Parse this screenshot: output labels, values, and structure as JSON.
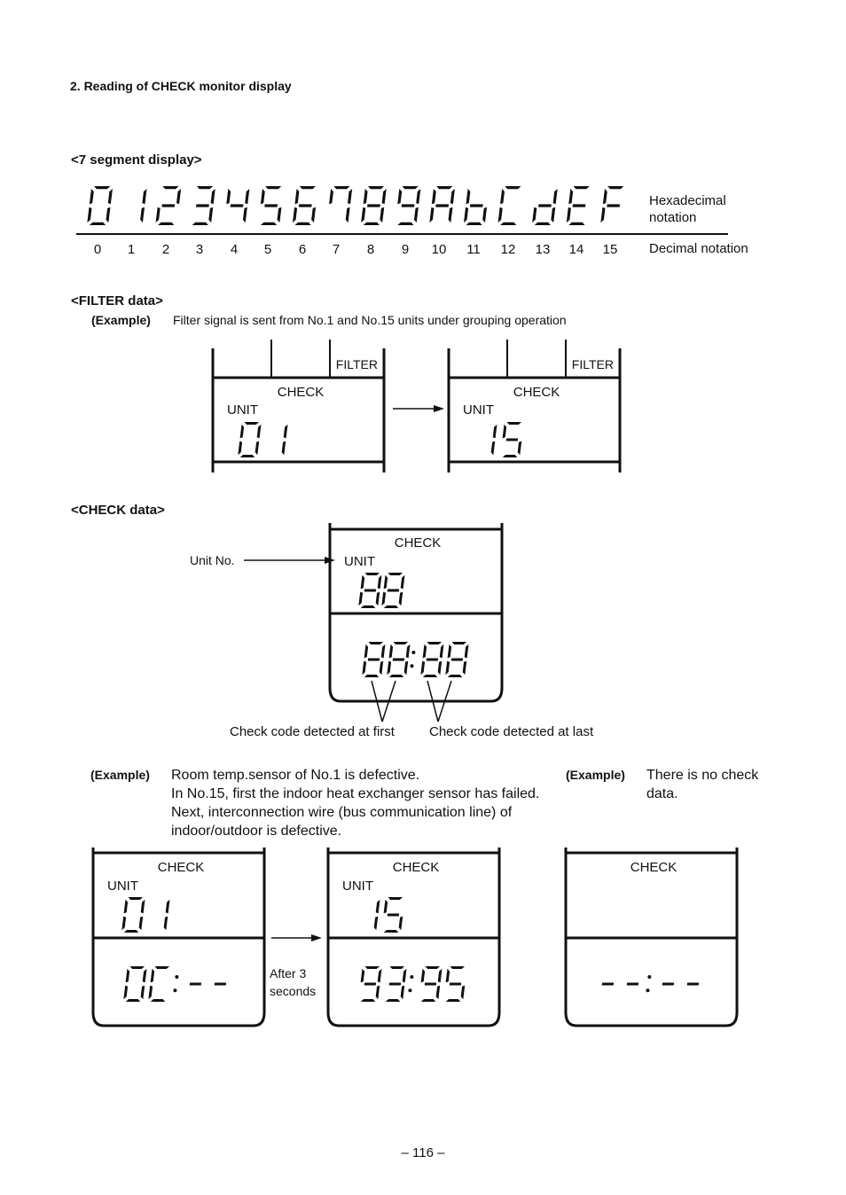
{
  "heading": "2.  Reading of CHECK monitor display",
  "seven_segment": {
    "title": "<7 segment display>",
    "hex_label_line1": "Hexadecimal",
    "hex_label_line2": "notation",
    "dec_label": "Decimal notation",
    "glyphs": [
      "0",
      "1",
      "2",
      "3",
      "4",
      "5",
      "6",
      "7",
      "8",
      "9",
      "A",
      "b",
      "C",
      "d",
      "E",
      "F"
    ],
    "decimals": [
      "0",
      "1",
      "2",
      "3",
      "4",
      "5",
      "6",
      "7",
      "8",
      "9",
      "10",
      "11",
      "12",
      "13",
      "14",
      "15"
    ]
  },
  "filter": {
    "title": "<FILTER data>",
    "example_label": "(Example)",
    "example_text": "Filter signal is sent from No.1 and No.15 units under grouping operation",
    "panels": [
      {
        "filter_label": "FILTER",
        "check_label": "CHECK",
        "unit_label": "UNIT",
        "unit_digits": "01"
      },
      {
        "filter_label": "FILTER",
        "check_label": "CHECK",
        "unit_label": "UNIT",
        "unit_digits": "15"
      }
    ]
  },
  "check": {
    "title": "<CHECK data>",
    "unit_no_label": "Unit No.",
    "check_label": "CHECK",
    "unit_label": "UNIT",
    "unit_digits": "88",
    "code_digits": "8888",
    "first_label": "Check code detected at first",
    "last_label": "Check code detected at last"
  },
  "examples": {
    "left": {
      "label": "(Example)",
      "lines": [
        "Room temp.sensor of No.1 is defective.",
        "In No.15, first the indoor heat exchanger sensor has failed.",
        "Next, interconnection wire (bus communication line) of",
        "indoor/outdoor is defective."
      ]
    },
    "right": {
      "label": "(Example)",
      "lines": [
        "There is no check",
        "data."
      ]
    },
    "after_label_line1": "After 3",
    "after_label_line2": "seconds",
    "panels": [
      {
        "check_label": "CHECK",
        "unit_label": "UNIT",
        "unit_digits": "01",
        "code_digits": "0C--"
      },
      {
        "check_label": "CHECK",
        "unit_label": "UNIT",
        "unit_digits": "15",
        "code_digits": "9395"
      },
      {
        "check_label": "CHECK",
        "unit_label": "",
        "unit_digits": "",
        "code_digits": "----"
      }
    ]
  },
  "page_number": "– 116 –"
}
